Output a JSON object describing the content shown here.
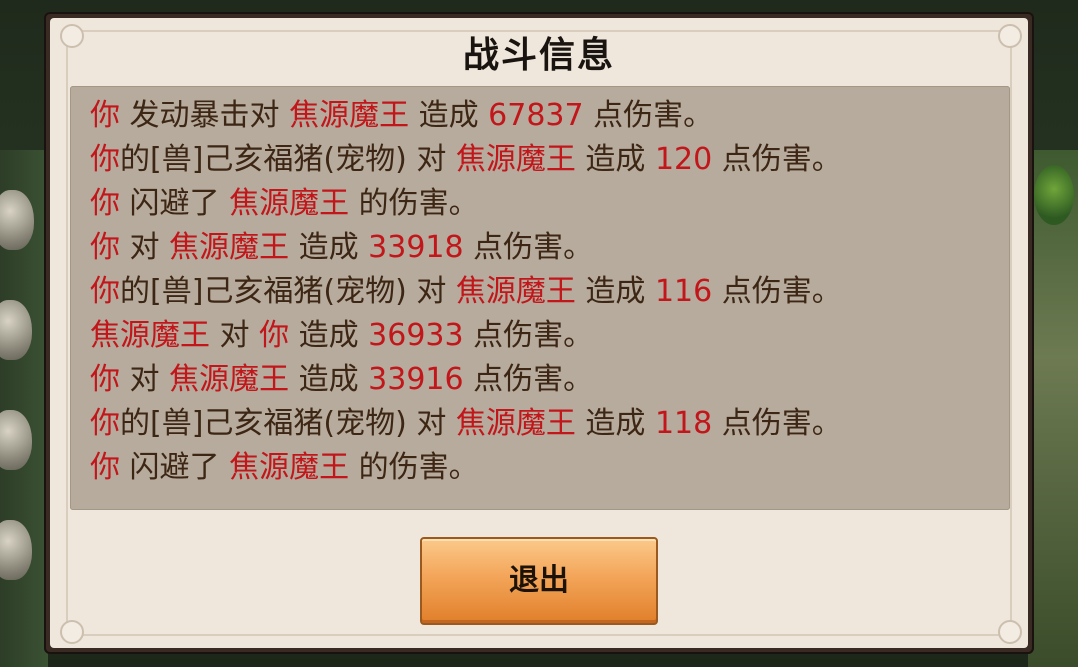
{
  "dialog": {
    "title": "战斗信息",
    "exit_label": "退出"
  },
  "colors": {
    "highlight": "#c2161b",
    "text": "#3d2614",
    "button": "#f3a559"
  },
  "log": [
    [
      {
        "t": "你",
        "c": "red"
      },
      {
        "t": " 发动暴击对 ",
        "c": "brown"
      },
      {
        "t": "焦源魔王",
        "c": "red"
      },
      {
        "t": " 造成 ",
        "c": "brown"
      },
      {
        "t": "67837",
        "c": "red"
      },
      {
        "t": " 点伤害。",
        "c": "brown"
      }
    ],
    [
      {
        "t": "你",
        "c": "red"
      },
      {
        "t": "的[兽]己亥福猪(宠物) 对 ",
        "c": "brown"
      },
      {
        "t": "焦源魔王",
        "c": "red"
      },
      {
        "t": " 造成 ",
        "c": "brown"
      },
      {
        "t": "120",
        "c": "red"
      },
      {
        "t": " 点伤害。",
        "c": "brown"
      }
    ],
    [
      {
        "t": "你",
        "c": "red"
      },
      {
        "t": " 闪避了 ",
        "c": "brown"
      },
      {
        "t": "焦源魔王",
        "c": "red"
      },
      {
        "t": " 的伤害。",
        "c": "brown"
      }
    ],
    [
      {
        "t": "你",
        "c": "red"
      },
      {
        "t": " 对 ",
        "c": "brown"
      },
      {
        "t": "焦源魔王",
        "c": "red"
      },
      {
        "t": " 造成 ",
        "c": "brown"
      },
      {
        "t": "33918",
        "c": "red"
      },
      {
        "t": " 点伤害。",
        "c": "brown"
      }
    ],
    [
      {
        "t": "你",
        "c": "red"
      },
      {
        "t": "的[兽]己亥福猪(宠物) 对 ",
        "c": "brown"
      },
      {
        "t": "焦源魔王",
        "c": "red"
      },
      {
        "t": " 造成 ",
        "c": "brown"
      },
      {
        "t": "116",
        "c": "red"
      },
      {
        "t": " 点伤害。",
        "c": "brown"
      }
    ],
    [
      {
        "t": "焦源魔王",
        "c": "red"
      },
      {
        "t": " 对 ",
        "c": "brown"
      },
      {
        "t": "你",
        "c": "red"
      },
      {
        "t": " 造成 ",
        "c": "brown"
      },
      {
        "t": "36933",
        "c": "red"
      },
      {
        "t": " 点伤害。",
        "c": "brown"
      }
    ],
    [
      {
        "t": "你",
        "c": "red"
      },
      {
        "t": " 对 ",
        "c": "brown"
      },
      {
        "t": "焦源魔王",
        "c": "red"
      },
      {
        "t": " 造成 ",
        "c": "brown"
      },
      {
        "t": "33916",
        "c": "red"
      },
      {
        "t": " 点伤害。",
        "c": "brown"
      }
    ],
    [
      {
        "t": "你",
        "c": "red"
      },
      {
        "t": "的[兽]己亥福猪(宠物) 对 ",
        "c": "brown"
      },
      {
        "t": "焦源魔王",
        "c": "red"
      },
      {
        "t": " 造成 ",
        "c": "brown"
      },
      {
        "t": "118",
        "c": "red"
      },
      {
        "t": " 点伤害。",
        "c": "brown"
      }
    ],
    [
      {
        "t": "你",
        "c": "red"
      },
      {
        "t": " 闪避了 ",
        "c": "brown"
      },
      {
        "t": "焦源魔王",
        "c": "red"
      },
      {
        "t": " 的伤害。",
        "c": "brown"
      }
    ]
  ]
}
